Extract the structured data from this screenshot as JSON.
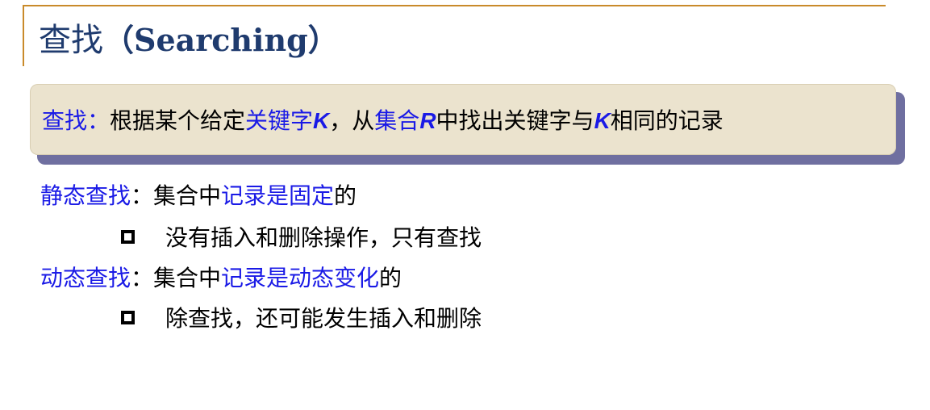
{
  "title": {
    "cn": "查找",
    "en": "（Searching）"
  },
  "definition": {
    "term": "查找：",
    "t1": "根据某个给定",
    "k1": "关键字",
    "v1": "K",
    "t2": "，从",
    "k2": "集合",
    "v2": "R",
    "t3": "中找出关键字与",
    "v3": "K",
    "t4": "相同的记录"
  },
  "static_section": {
    "term": "静态查找",
    "t1": "：集合中",
    "k1": "记录是固定",
    "t2": "的",
    "bullet": "没有插入和删除操作，只有查找"
  },
  "dynamic_section": {
    "term": "动态查找",
    "t1": "：集合中",
    "k1": "记录是动态变化",
    "t2": "的",
    "bullet": "除查找，还可能发生插入和删除"
  },
  "colors": {
    "accent_rule": "#c98a2a",
    "title": "#1f3b6e",
    "keyword_blue": "#1a1ae6",
    "callout_bg": "#ebe3ce",
    "callout_shadow": "#6f6fa0"
  }
}
